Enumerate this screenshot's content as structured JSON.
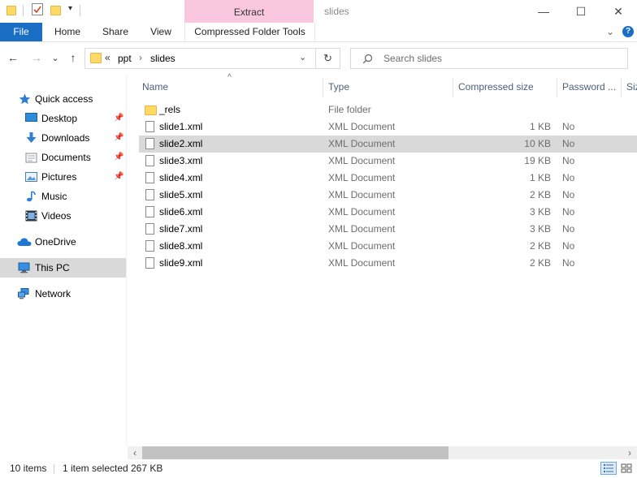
{
  "window": {
    "title": "slides",
    "contextual_header": "Extract",
    "controls": {
      "minimize": "—",
      "maximize": "☐",
      "close": "✕"
    },
    "quick_access_toolbar": {
      "icons": [
        "folder-icon",
        "properties-check-icon",
        "new-folder-icon",
        "customize-dropdown-icon"
      ],
      "dropdown_glyph": "▾"
    }
  },
  "ribbon": {
    "tabs": [
      {
        "id": "file",
        "label": "File"
      },
      {
        "id": "home",
        "label": "Home"
      },
      {
        "id": "share",
        "label": "Share"
      },
      {
        "id": "view",
        "label": "View"
      },
      {
        "id": "compressed",
        "label": "Compressed Folder Tools"
      }
    ],
    "expand_glyph": "⌄",
    "help_glyph": "?",
    "accent": "#1a6ec4",
    "contextual_color": "#f9c7de"
  },
  "navigation": {
    "back_glyph": "←",
    "forward_glyph": "→",
    "recent_glyph": "⌄",
    "up_glyph": "↑",
    "breadcrumb": {
      "overflow": "«",
      "separator": "›",
      "items": [
        "ppt",
        "slides"
      ]
    },
    "address_dropdown_glyph": "⌄",
    "refresh_glyph": "↻",
    "search": {
      "placeholder": "Search slides",
      "icon": "search-icon"
    }
  },
  "nav_pane": {
    "pin_glyph": "📌",
    "items": [
      {
        "label": "Quick access",
        "icon": "star-icon",
        "pinned": false,
        "selected": false
      },
      {
        "label": "Desktop",
        "icon": "desktop-icon",
        "pinned": true,
        "selected": false
      },
      {
        "label": "Downloads",
        "icon": "download-arrow-icon",
        "pinned": true,
        "selected": false
      },
      {
        "label": "Documents",
        "icon": "documents-icon",
        "pinned": true,
        "selected": false
      },
      {
        "label": "Pictures",
        "icon": "pictures-icon",
        "pinned": true,
        "selected": false
      },
      {
        "label": "Music",
        "icon": "music-note-icon",
        "pinned": false,
        "selected": false
      },
      {
        "label": "Videos",
        "icon": "film-icon",
        "pinned": false,
        "selected": false
      },
      {
        "label": "OneDrive",
        "icon": "cloud-icon",
        "pinned": false,
        "selected": false
      },
      {
        "label": "This PC",
        "icon": "computer-icon",
        "pinned": false,
        "selected": true
      },
      {
        "label": "Network",
        "icon": "network-icon",
        "pinned": false,
        "selected": false
      }
    ]
  },
  "file_list": {
    "sort_glyph": "^",
    "columns": [
      "Name",
      "Type",
      "Compressed size",
      "Password ...",
      "Siz"
    ],
    "rows": [
      {
        "name": "_rels",
        "type": "File folder",
        "size": "",
        "password": "",
        "kind": "folder",
        "selected": false
      },
      {
        "name": "slide1.xml",
        "type": "XML Document",
        "size": "1 KB",
        "password": "No",
        "kind": "file",
        "selected": false
      },
      {
        "name": "slide2.xml",
        "type": "XML Document",
        "size": "10 KB",
        "password": "No",
        "kind": "file",
        "selected": true
      },
      {
        "name": "slide3.xml",
        "type": "XML Document",
        "size": "19 KB",
        "password": "No",
        "kind": "file",
        "selected": false
      },
      {
        "name": "slide4.xml",
        "type": "XML Document",
        "size": "1 KB",
        "password": "No",
        "kind": "file",
        "selected": false
      },
      {
        "name": "slide5.xml",
        "type": "XML Document",
        "size": "2 KB",
        "password": "No",
        "kind": "file",
        "selected": false
      },
      {
        "name": "slide6.xml",
        "type": "XML Document",
        "size": "3 KB",
        "password": "No",
        "kind": "file",
        "selected": false
      },
      {
        "name": "slide7.xml",
        "type": "XML Document",
        "size": "3 KB",
        "password": "No",
        "kind": "file",
        "selected": false
      },
      {
        "name": "slide8.xml",
        "type": "XML Document",
        "size": "2 KB",
        "password": "No",
        "kind": "file",
        "selected": false
      },
      {
        "name": "slide9.xml",
        "type": "XML Document",
        "size": "2 KB",
        "password": "No",
        "kind": "file",
        "selected": false
      }
    ],
    "scroll_left_glyph": "‹",
    "scroll_right_glyph": "›"
  },
  "status_bar": {
    "item_count": "10 items",
    "selection": "1 item selected",
    "selection_size": "267 KB",
    "view_icons": [
      "details-view-icon",
      "large-icons-view-icon"
    ]
  }
}
